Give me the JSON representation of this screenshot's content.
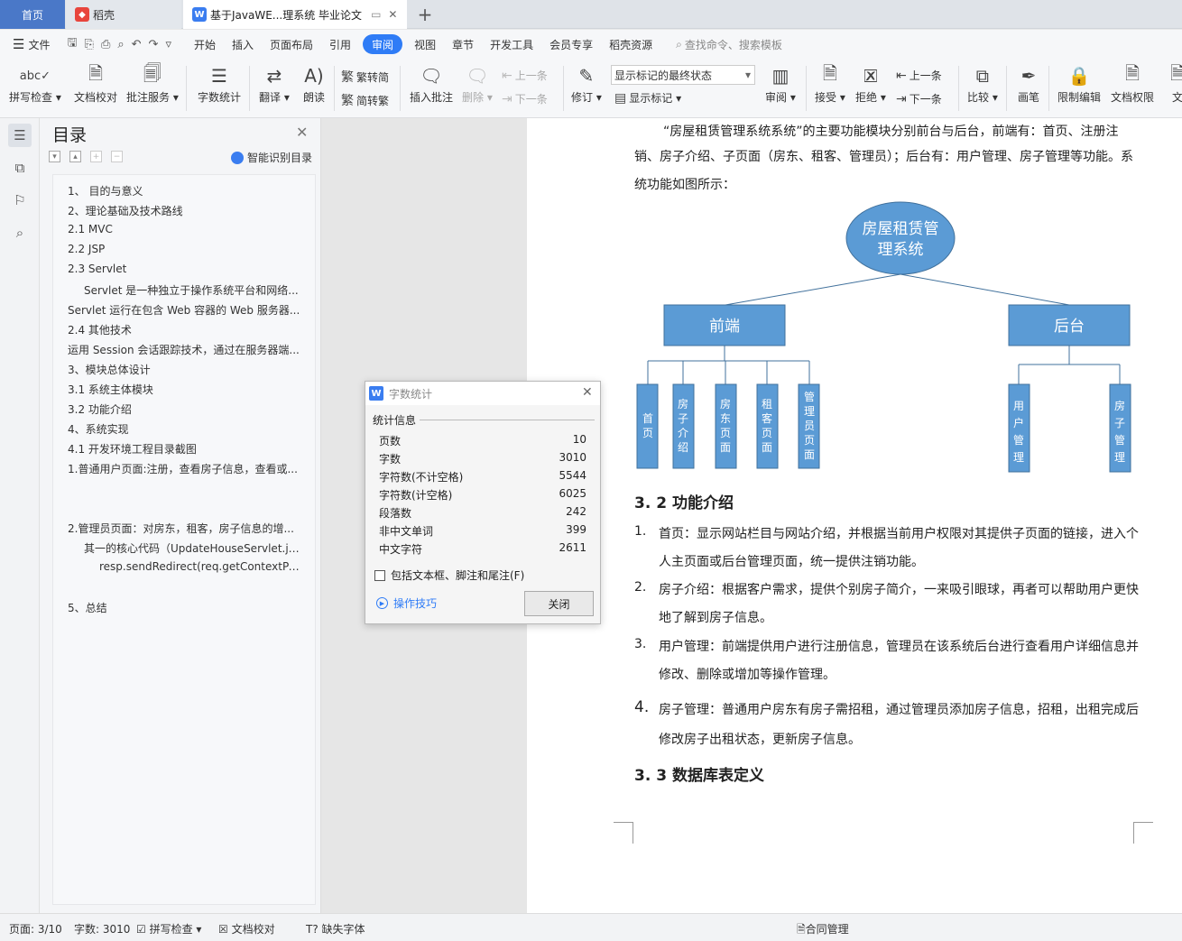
{
  "tabs": {
    "home": "首页",
    "daoke": "稻壳",
    "doc": "基于JavaWE...理系统 毕业论文"
  },
  "menu": {
    "file": "文件",
    "items": [
      "开始",
      "插入",
      "页面布局",
      "引用",
      "审阅",
      "视图",
      "章节",
      "开发工具",
      "会员专享",
      "稻壳资源"
    ],
    "search": "查找命令、搜索模板"
  },
  "ribbon": {
    "spell": "拼写检查",
    "proof": "文档校对",
    "annotate": "批注服务",
    "wordcount": "字数统计",
    "translate": "翻译",
    "read": "朗读",
    "t2s": "繁转简",
    "s2t": "简转繁",
    "insert_comment": "插入批注",
    "delete": "删除",
    "prev": "上一条",
    "next": "下一条",
    "revise": "修订",
    "markup_select": "显示标记的最终状态",
    "show_markup": "显示标记",
    "review": "审阅",
    "accept": "接受",
    "reject": "拒绝",
    "prev2": "上一条",
    "next2": "下一条",
    "compare": "比较",
    "pen": "画笔",
    "restrict": "限制编辑",
    "doc_perm": "文档权限",
    "doc_more": "文"
  },
  "nav": {
    "title": "目录",
    "smart": "智能识别目录",
    "items": [
      "1、  目的与意义",
      "2、理论基础及技术路线",
      "2.1 MVC",
      "2.2 JSP",
      "2.3 Servlet",
      "Servlet 是一种独立于操作系统平台和网络...",
      "Servlet 运行在包含 Web 容器的 Web 服务器...",
      "2.4  其他技术",
      "运用 Session 会话跟踪技术，通过在服务器端...",
      "3、模块总体设计",
      "3.1 系统主体模块",
      "3.2 功能介绍",
      "4、系统实现",
      "4.1 开发环境工程目录截图",
      "1.普通用户页面:注册，查看房子信息，查看或...",
      "2.管理员页面：对房东，租客，房子信息的增...",
      "其一的核心代码（UpdateHouseServlet.ja...",
      "resp.sendRedirect(req.getContextPat...",
      "5、总结"
    ]
  },
  "doc": {
    "intro": [
      "“房屋租赁管理系统系统”的主要功能模块分别前台与后台，前端有：首页、注册注",
      "销、房子介绍、子页面（房东、租客、管理员）；后台有：用户管理、房子管理等功能。系",
      "统功能如图所示："
    ],
    "diagram": {
      "root": "房屋租赁管理系统",
      "front": "前端",
      "back": "后台",
      "front_children": [
        "首页",
        "房子介绍",
        "房东页面",
        "租客页面",
        "管理员页面"
      ],
      "back_children": [
        "用户管理",
        "房子管理"
      ]
    },
    "h32": "3. 2 功能介绍",
    "list": [
      {
        "n": "1.",
        "l1": "首页：显示网站栏目与网站介绍，并根据当前用户权限对其提供子页面的链接，进入个",
        "l2": "人主页面或后台管理页面，统一提供注销功能。"
      },
      {
        "n": "2.",
        "l1": "房子介绍：根据客户需求，提供个别房子简介，一来吸引眼球，再者可以帮助用户更快",
        "l2": "地了解到房子信息。"
      },
      {
        "n": "3.",
        "l1": "用户管理：前端提供用户进行注册信息，管理员在该系统后台进行查看用户详细信息并",
        "l2": "修改、删除或增加等操作管理。"
      },
      {
        "n": "4.",
        "l1": "房子管理：普通用户房东有房子需招租，通过管理员添加房子信息，招租，出租完成后",
        "l2": "修改房子出租状态，更新房子信息。"
      }
    ],
    "h33": "3. 3 数据库表定义"
  },
  "dialog": {
    "title": "字数统计",
    "section": "统计信息",
    "rows": [
      {
        "k": "页数",
        "v": "10"
      },
      {
        "k": "字数",
        "v": "3010"
      },
      {
        "k": "字符数(不计空格)",
        "v": "5544"
      },
      {
        "k": "字符数(计空格)",
        "v": "6025"
      },
      {
        "k": "段落数",
        "v": "242"
      },
      {
        "k": "非中文单词",
        "v": "399"
      },
      {
        "k": "中文字符",
        "v": "2611"
      }
    ],
    "checkbox": "包括文本框、脚注和尾注(F)",
    "tips": "操作技巧",
    "close": "关闭"
  },
  "status": {
    "page": "页面: 3/10",
    "words": "字数: 3010",
    "spell": "拼写检查",
    "proof": "文档校对",
    "font": "缺失字体",
    "contract": "合同管理"
  },
  "colors": {
    "accent": "#2f7cf6",
    "box": "#5b9bd5",
    "box_border": "#41719c"
  }
}
